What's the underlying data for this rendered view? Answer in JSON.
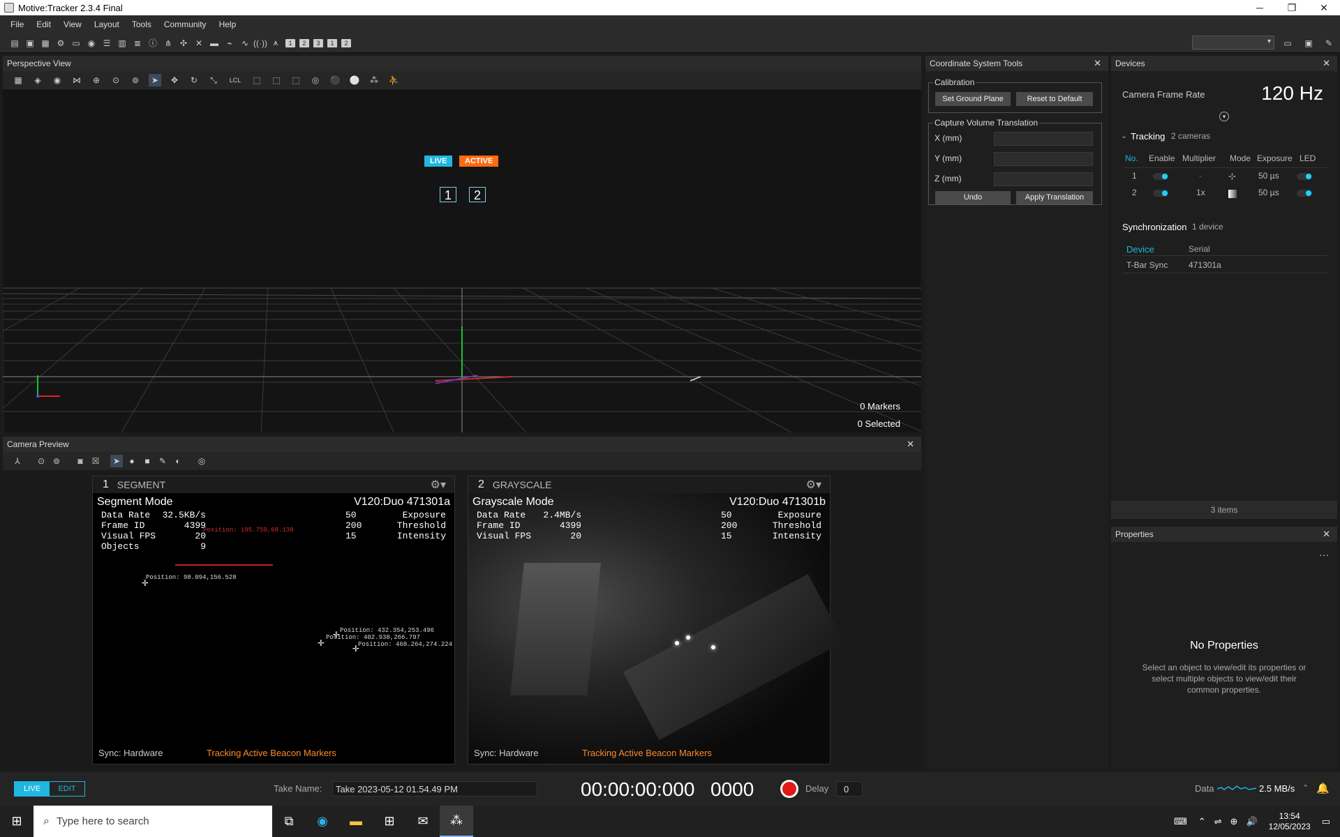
{
  "window": {
    "title": "Motive:Tracker 2.3.4 Final",
    "minimize": "─",
    "maximize": "❐",
    "close": "✕"
  },
  "menu": [
    "File",
    "Edit",
    "View",
    "Layout",
    "Tools",
    "Community",
    "Help"
  ],
  "toolbar": {
    "numbers": [
      "1",
      "2",
      "3",
      "1",
      "2"
    ]
  },
  "perspective": {
    "title": "Perspective View",
    "close": "✕",
    "lcl": "LCL",
    "live": "LIVE",
    "active": "ACTIVE",
    "cameras": [
      "1",
      "2"
    ],
    "markers": "0 Markers",
    "selected": "0 Selected"
  },
  "camera_preview": {
    "title": "Camera Preview",
    "close": "✕",
    "cams": [
      {
        "num": "1",
        "mode_tag": "SEGMENT",
        "mode": "Segment Mode",
        "model": "V120:Duo 471301a",
        "data_rate_label": "Data Rate",
        "data_rate": "32.5KB/s",
        "frame_label": "Frame ID",
        "frame": "4399",
        "fps_label": "Visual FPS",
        "fps": "20",
        "objects_label": "Objects",
        "objects": "9",
        "exposure": "50",
        "exposure_label": "Exposure",
        "threshold": "200",
        "threshold_label": "Threshold",
        "intensity": "15",
        "intensity_label": "Intensity",
        "sync": "Sync: Hardware",
        "tracking": "Tracking Active Beacon Markers",
        "markers": [
          {
            "label": "Position: 195.759,68.138"
          },
          {
            "label": "Position: 98.094,156.528"
          },
          {
            "label": "Position: 432.354,253.496"
          },
          {
            "label": "Position: 402.938,266.797"
          },
          {
            "label": "Position: 468.264,274.224"
          }
        ]
      },
      {
        "num": "2",
        "mode_tag": "GRAYSCALE",
        "mode": "Grayscale Mode",
        "model": "V120:Duo 471301b",
        "data_rate_label": "Data Rate",
        "data_rate": "2.4MB/s",
        "frame_label": "Frame ID",
        "frame": "4399",
        "fps_label": "Visual FPS",
        "fps": "20",
        "exposure": "50",
        "exposure_label": "Exposure",
        "threshold": "200",
        "threshold_label": "Threshold",
        "intensity": "15",
        "intensity_label": "Intensity",
        "sync": "Sync: Hardware",
        "tracking": "Tracking Active Beacon Markers"
      }
    ]
  },
  "cst": {
    "title": "Coordinate System Tools",
    "close": "✕",
    "calibration": "Calibration",
    "set_ground": "Set Ground Plane",
    "reset_default": "Reset to Default",
    "translation": "Capture Volume Translation",
    "x": "X (mm)",
    "y": "Y (mm)",
    "z": "Z (mm)",
    "undo": "Undo",
    "apply": "Apply Translation"
  },
  "devices": {
    "title": "Devices",
    "close": "✕",
    "frame_rate_label": "Camera Frame Rate",
    "frame_rate": "120 Hz",
    "tracking": "Tracking",
    "tracking_count": "2 cameras",
    "columns": [
      "No.",
      "Enable",
      "Multiplier",
      "Mode",
      "Exposure",
      "LED"
    ],
    "rows": [
      {
        "no": "1",
        "multiplier": "-",
        "exposure": "50 µs"
      },
      {
        "no": "2",
        "multiplier": "1x",
        "exposure": "50 µs"
      }
    ],
    "sync": "Synchronization",
    "sync_count": "1 device",
    "sync_cols": [
      "Device",
      "Serial"
    ],
    "sync_row": {
      "device": "T-Bar Sync",
      "serial": "471301a"
    },
    "items": "3 items"
  },
  "properties": {
    "title": "Properties",
    "close": "✕",
    "more": "···",
    "empty_title": "No Properties",
    "empty_text": "Select an object to view/edit its properties or select multiple objects to view/edit their common properties."
  },
  "bottom": {
    "live": "LIVE",
    "edit": "EDIT",
    "take_label": "Take Name:",
    "take_value": "Take 2023-05-12 01.54.49 PM",
    "timecode": "00:00:00:000",
    "frame": "0000",
    "delay_label": "Delay",
    "delay": "0",
    "data_label": "Data",
    "data_rate": "2.5 MB/s"
  },
  "taskbar": {
    "search": "Type here to search",
    "time": "13:54",
    "date": "12/05/2023"
  }
}
